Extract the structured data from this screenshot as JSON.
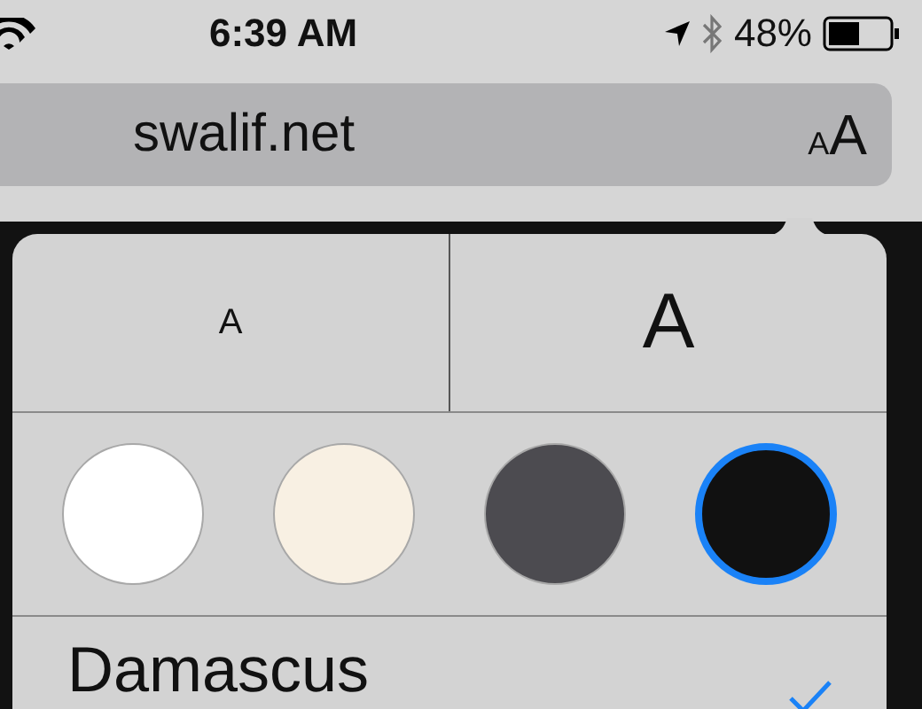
{
  "status_bar": {
    "time": "6:39 AM",
    "battery": "48%"
  },
  "address_bar": {
    "url": "swalif.net",
    "text_size_button": {
      "small": "A",
      "large": "A"
    }
  },
  "popover": {
    "font_size_buttons": [
      {
        "label": "A",
        "kind": "smaller"
      },
      {
        "label": "A",
        "kind": "larger"
      }
    ],
    "themes": [
      {
        "color": "#ffffff",
        "selected": false
      },
      {
        "color": "#f8f0e3",
        "selected": false
      },
      {
        "color": "#4c4b50",
        "selected": false
      },
      {
        "color": "#111111",
        "selected": true
      }
    ],
    "fonts": [
      {
        "name": "Damascus",
        "selected": true
      }
    ]
  }
}
